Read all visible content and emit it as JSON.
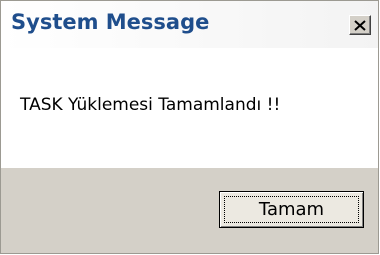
{
  "dialog": {
    "title": "System Message",
    "close_icon": "close-icon",
    "message": "TASK Yüklemesi Tamamlandı !!",
    "ok_label": "Tamam"
  },
  "colors": {
    "title_text": "#1f4e8c",
    "dialog_face": "#d4d0c8",
    "content_bg": "#ffffff"
  }
}
